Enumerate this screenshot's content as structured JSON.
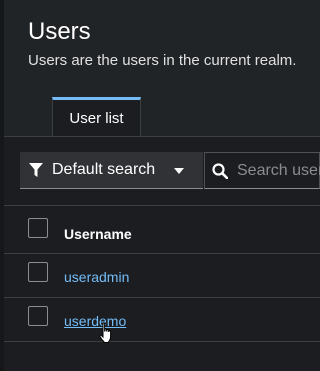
{
  "header": {
    "title": "Users",
    "description": "Users are the users in the current realm."
  },
  "tabs": [
    {
      "label": "User list",
      "active": true
    }
  ],
  "toolbar": {
    "filter_label": "Default search",
    "search_placeholder": "Search user"
  },
  "table": {
    "columns": [
      "Username"
    ],
    "rows": [
      {
        "username": "useradmin"
      },
      {
        "username": "userdemo"
      }
    ]
  },
  "colors": {
    "background": "#1b1d21",
    "header_background": "#212427",
    "accent": "#73bcf7",
    "link": "#73bcf7"
  },
  "icons": [
    "filter-icon",
    "caret-down-icon",
    "search-icon",
    "pointer-cursor-icon"
  ]
}
